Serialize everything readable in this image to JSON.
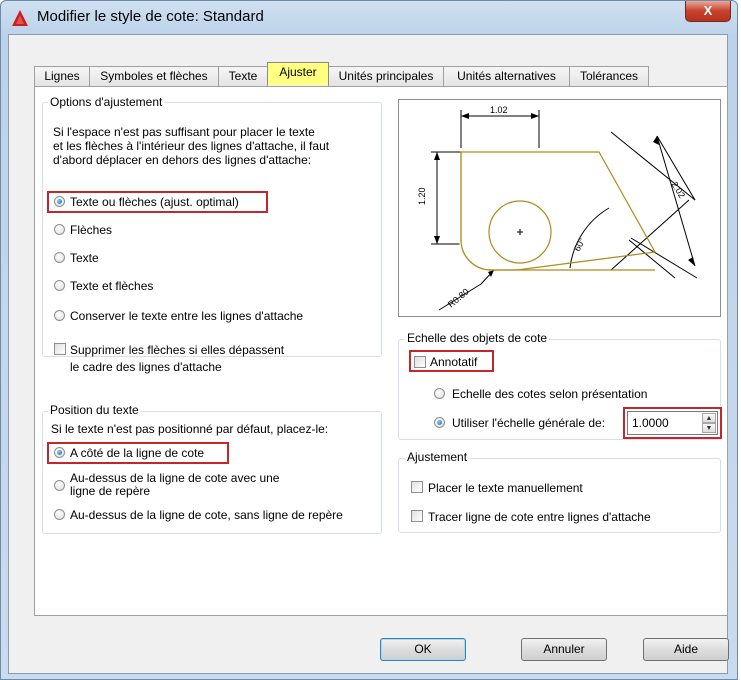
{
  "window": {
    "title": "Modifier le style de cote: Standard",
    "close_glyph": "X"
  },
  "tabs": [
    {
      "label": "Lignes",
      "active": false
    },
    {
      "label": "Symboles et flèches",
      "active": false
    },
    {
      "label": "Texte",
      "active": false
    },
    {
      "label": "Ajuster",
      "active": true
    },
    {
      "label": "Unités principales",
      "active": false
    },
    {
      "label": "Unités alternatives",
      "active": false
    },
    {
      "label": "Tolérances",
      "active": false
    }
  ],
  "options_ajustement": {
    "legend": "Options d'ajustement",
    "description": [
      "Si l'espace n'est pas suffisant pour placer le texte",
      "et les flèches à l'intérieur des lignes d'attache, il faut",
      "d'abord déplacer en dehors des lignes d'attache:"
    ],
    "radios": [
      {
        "label": "Texte ou flèches (ajust. optimal)",
        "selected": true
      },
      {
        "label": "Flèches",
        "selected": false
      },
      {
        "label": "Texte",
        "selected": false
      },
      {
        "label": "Texte et flèches",
        "selected": false
      },
      {
        "label": "Conserver le texte entre les lignes d'attache",
        "selected": false
      }
    ],
    "suppress_checkbox": {
      "line1": "Supprimer les flèches si elles dépassent",
      "line2": "le cadre des lignes d'attache",
      "checked": false
    }
  },
  "position_texte": {
    "legend": "Position du texte",
    "description": "Si le texte n'est pas positionné par défaut, placez-le:",
    "radios": [
      {
        "label": "A côté de la ligne de cote",
        "selected": true
      },
      {
        "label": "Au-dessus de la ligne de cote avec une",
        "label2": "ligne de repère",
        "selected": false
      },
      {
        "label": "Au-dessus de la ligne de cote, sans ligne de repère",
        "selected": false
      }
    ]
  },
  "preview": {
    "dim_top": "1.02",
    "dim_left": "1.20",
    "dim_diag": "2.02",
    "dim_angle": "60°",
    "dim_radius": "R0.80"
  },
  "echelle": {
    "legend": "Echelle des objets de cote",
    "annotatif_label": "Annotatif",
    "annotatif_checked": false,
    "radio_presentation": "Echelle des cotes selon présentation",
    "radio_generale": "Utiliser l'échelle générale de:",
    "scale_value": "1.0000"
  },
  "ajustement": {
    "legend": "Ajustement",
    "check_manual": "Placer le texte manuellement",
    "check_trace": "Tracer ligne de cote entre lignes d'attache"
  },
  "buttons": {
    "ok": "OK",
    "cancel": "Annuler",
    "help": "Aide"
  },
  "colors": {
    "highlight": "#c1272d",
    "active_tab": "#ffff80",
    "preview_line": "#b08a1c"
  }
}
